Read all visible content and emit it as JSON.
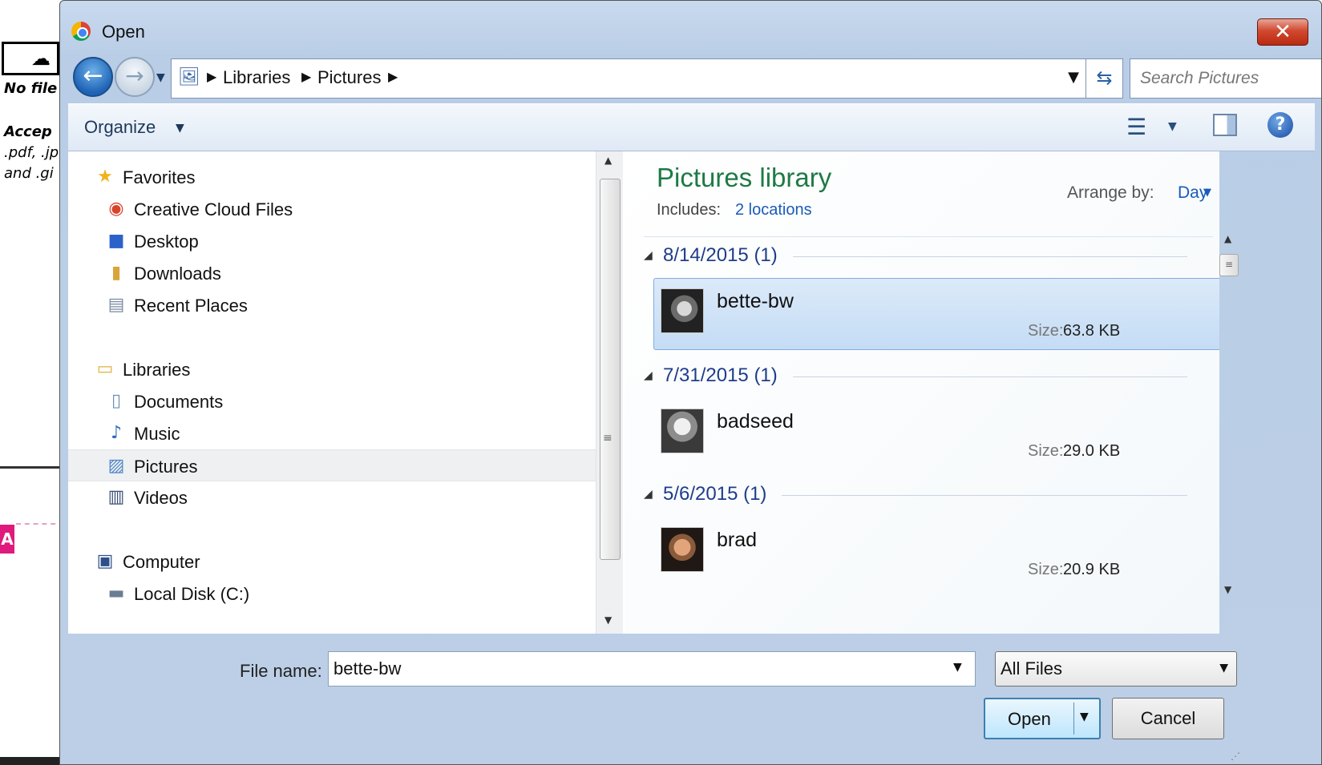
{
  "background": {
    "no_file_text": "No file",
    "accept_text": "Accep",
    "formats_text": ".pdf, .jp",
    "and_text": "and .gi",
    "pink_label": "A"
  },
  "dialog": {
    "title": "Open",
    "close_glyph": "✕",
    "breadcrumbs": [
      "Libraries",
      "Pictures"
    ],
    "search_placeholder": "Search Pictures",
    "organize_label": "Organize",
    "help_glyph": "?"
  },
  "navpane": {
    "favorites_label": "Favorites",
    "favorites": [
      "Creative Cloud Files",
      "Desktop",
      "Downloads",
      "Recent Places"
    ],
    "libraries_label": "Libraries",
    "libraries": [
      "Documents",
      "Music",
      "Pictures",
      "Videos"
    ],
    "computer_label": "Computer",
    "computer": [
      "Local Disk (C:)"
    ],
    "selected": "Pictures"
  },
  "content": {
    "library_title": "Pictures library",
    "includes_label": "Includes:",
    "includes_link": "2 locations",
    "arrange_label": "Arrange by:",
    "arrange_value": "Day",
    "groups": [
      {
        "title": "8/14/2015 (1)",
        "file": {
          "name": "bette-bw",
          "size_label": "Size:",
          "size": "63.8 KB",
          "selected": true
        }
      },
      {
        "title": "7/31/2015 (1)",
        "file": {
          "name": "badseed",
          "size_label": "Size:",
          "size": "29.0 KB",
          "selected": false
        }
      },
      {
        "title": "5/6/2015 (1)",
        "file": {
          "name": "brad",
          "size_label": "Size:",
          "size": "20.9 KB",
          "selected": false
        }
      }
    ]
  },
  "bottom": {
    "file_name_label": "File name:",
    "file_name_value": "bette-bw",
    "filter_value": "All Files",
    "open_label": "Open",
    "cancel_label": "Cancel"
  },
  "icons": {
    "back": "arrow-left-icon",
    "forward": "arrow-right-icon",
    "refresh": "refresh-icon",
    "search": "search-icon",
    "views": "view-list-icon",
    "preview": "preview-pane-icon",
    "help": "help-icon"
  },
  "colors": {
    "library_title": "#1e7a45",
    "link": "#1a5bb8",
    "close_button": "#c8391d",
    "selection": "#c4dcf5",
    "pink_accent": "#e0197d"
  }
}
